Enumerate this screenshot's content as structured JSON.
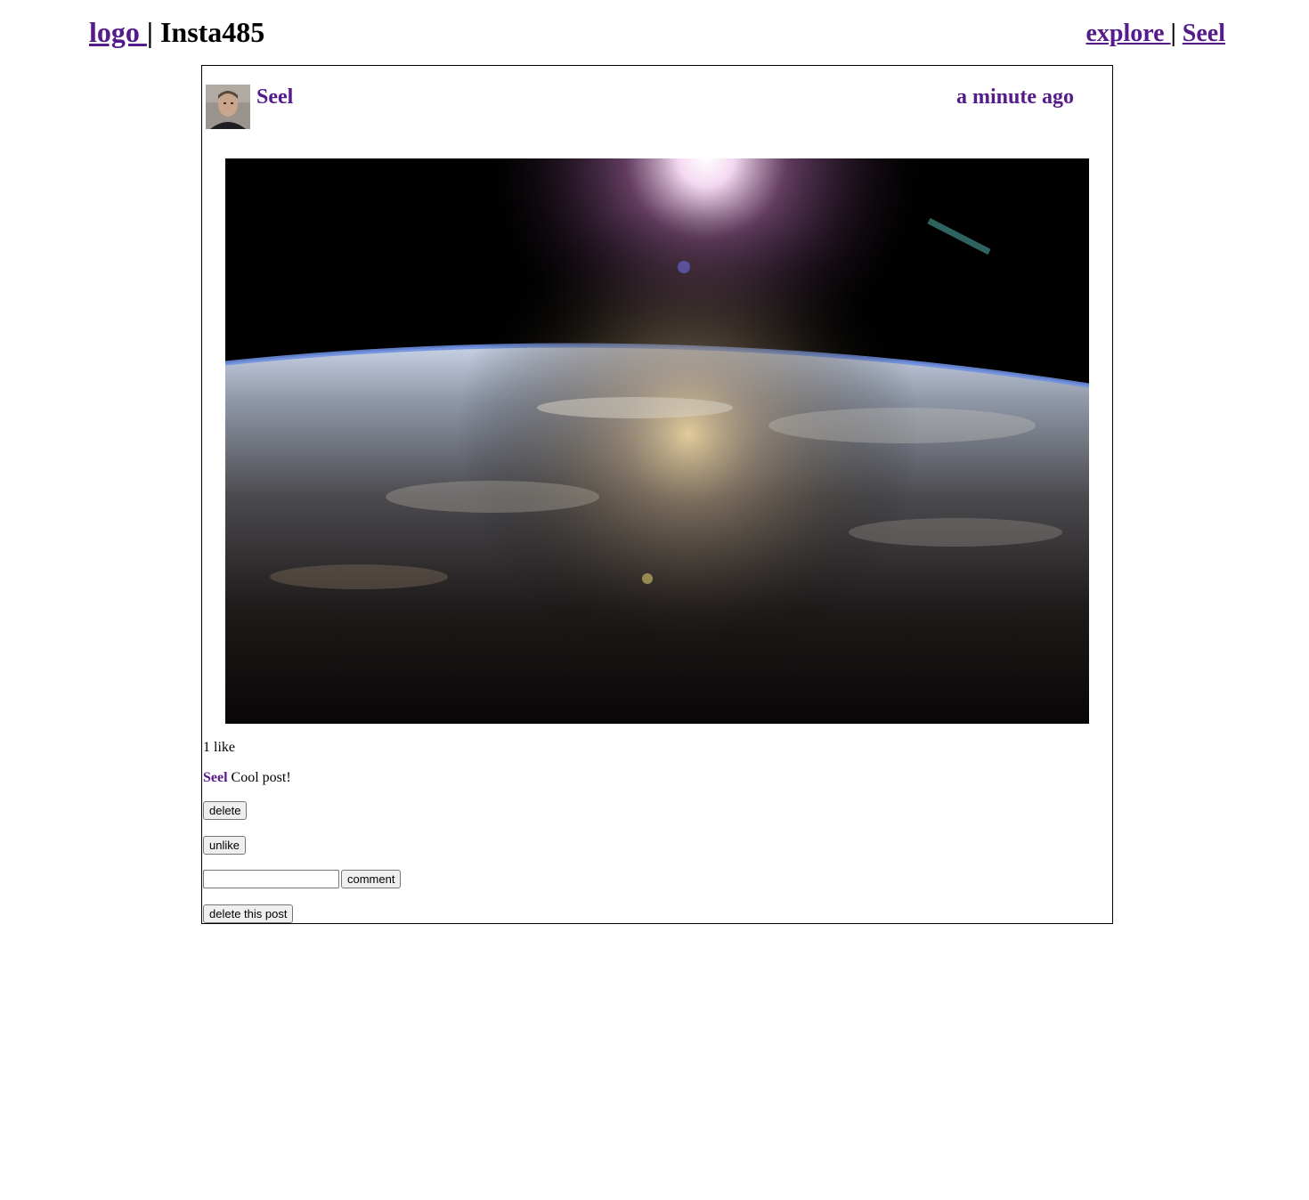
{
  "header": {
    "logo_label": "logo ",
    "separator": "|",
    "title": "Insta485",
    "explore_label": "explore ",
    "nav_separator": "|",
    "user_label": "Seel"
  },
  "post": {
    "owner": "Seel",
    "timestamp": "a minute ago",
    "likes_text": "1 like",
    "comments": [
      {
        "owner": "Seel",
        "text": "Cool post!"
      }
    ],
    "delete_comment_label": "delete",
    "unlike_label": "unlike",
    "comment_input_value": "",
    "comment_button_label": "comment",
    "delete_post_label": "delete this post"
  },
  "colors": {
    "link": "#551a8b",
    "border": "#000000"
  }
}
